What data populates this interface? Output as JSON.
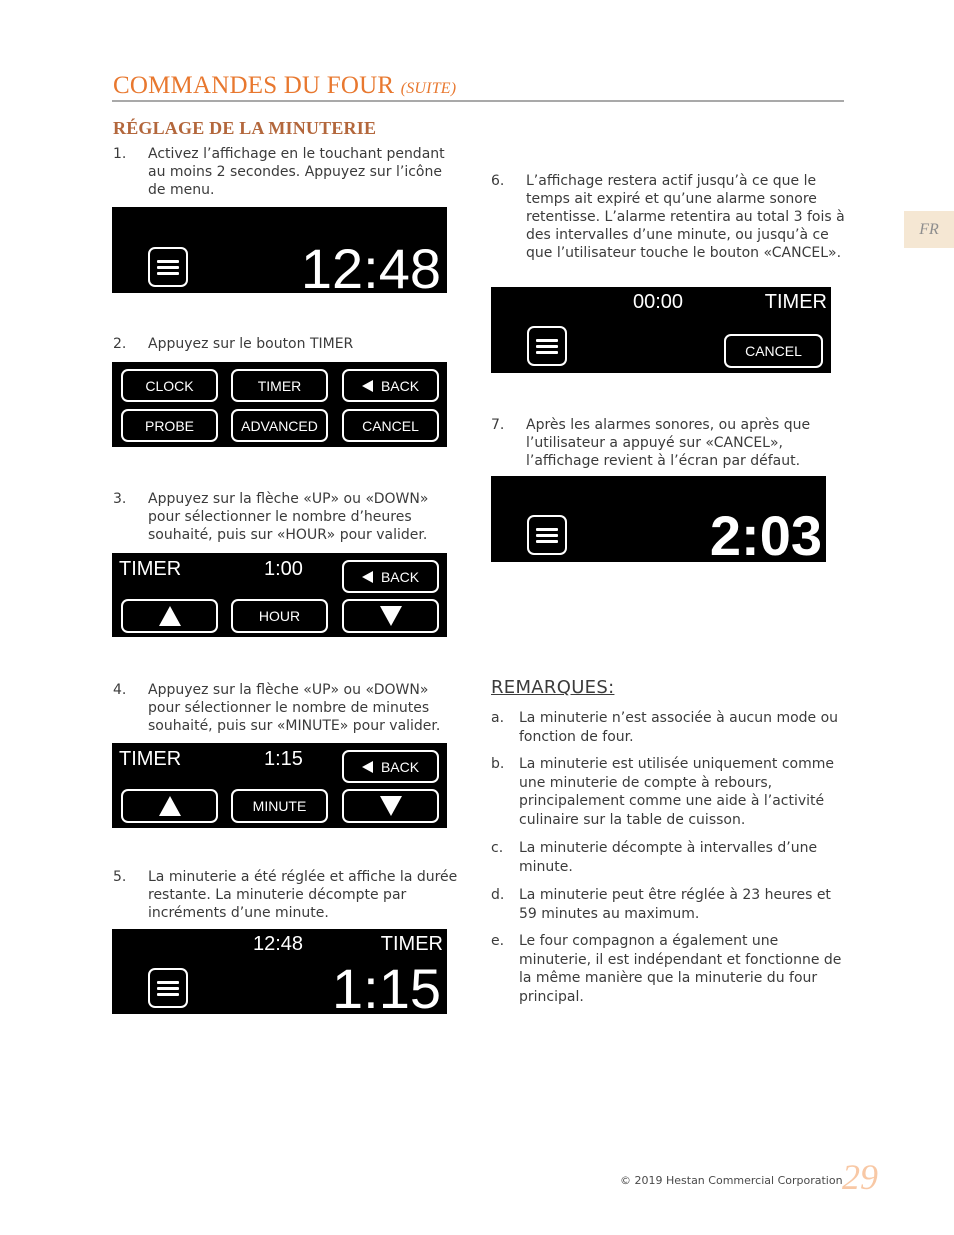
{
  "header": {
    "title": "COMMANDES DU FOUR",
    "title_suffix": "(SUITE)",
    "section_title": "RÉGLAGE DE LA MINUTERIE",
    "language_tab": "FR"
  },
  "colors": {
    "title": "#e8782f",
    "section_title": "#b3673c",
    "language_tab_bg": "#f5e7d3",
    "page_number": "#f8c8a5"
  },
  "steps": [
    {
      "num": "1.",
      "text": "Activez l’affichage en le touchant pendant au moins 2 secondes.  Appuyez sur l’icône de menu."
    },
    {
      "num": "2.",
      "text": "Appuyez sur le bouton   TIMER"
    },
    {
      "num": "3.",
      "text": "Appuyez sur la flèche «UP» ou «DOWN» pour sélectionner le nombre d’heures souhaité, puis sur «HOUR» pour valider."
    },
    {
      "num": "4.",
      "text": "Appuyez sur la flèche «UP» ou «DOWN» pour sélectionner le nombre de minutes souhaité, puis sur «MINUTE» pour valider."
    },
    {
      "num": "5.",
      "text": "La minuterie a été réglée et affiche la durée restante.  La minuterie décompte par incréments d’une minute."
    },
    {
      "num": "6.",
      "text": "L’affichage restera actif jusqu’à ce que le temps ait expiré et qu’une alarme sonore retentisse.  L’alarme retentira au total 3 fois à des intervalles d’une minute, ou jusqu’à ce que l’utilisateur touche le bouton «CANCEL»."
    },
    {
      "num": "7.",
      "text": "Après les alarmes sonores, ou après que l’utilisateur a appuyé sur «CANCEL», l’affichage revient à l’écran par défaut."
    }
  ],
  "screens": {
    "s1": {
      "clock": "12:48",
      "icon": "menu-icon"
    },
    "s2": {
      "buttons": [
        "CLOCK",
        "TIMER",
        "BACK",
        "PROBE",
        "ADVANCED",
        "CANCEL"
      ]
    },
    "s3": {
      "label": "TIMER",
      "value": "1:00",
      "back": "BACK",
      "confirm": "HOUR"
    },
    "s4": {
      "label": "TIMER",
      "value": "1:15",
      "back": "BACK",
      "confirm": "MINUTE"
    },
    "s5": {
      "clock": "12:48",
      "label": "TIMER",
      "remaining": "1:15"
    },
    "s6": {
      "value": "00:00",
      "label": "TIMER",
      "cancel": "CANCEL"
    },
    "s7": {
      "clock": "2:03"
    }
  },
  "remarks": {
    "title": "REMARQUES:",
    "items": [
      {
        "num": "a.",
        "text": "La minuterie n’est associée à aucun mode ou fonction de four."
      },
      {
        "num": "b.",
        "text": "La minuterie est utilisée uniquement comme une minuterie de compte à rebours, principalement comme une aide à l’activité culinaire sur la table de cuisson."
      },
      {
        "num": "c.",
        "text": "La minuterie décompte à intervalles d’une minute."
      },
      {
        "num": "d.",
        "text": "La minuterie peut être réglée à 23 heures et 59 minutes au maximum."
      },
      {
        "num": "e.",
        "text": "Le four compagnon a également une minuterie, il est indépendant et fonctionne de la même manière que la minuterie du four principal."
      }
    ]
  },
  "footer": {
    "copyright": "© 2019 Hestan Commercial Corporation",
    "page_number": "29"
  }
}
